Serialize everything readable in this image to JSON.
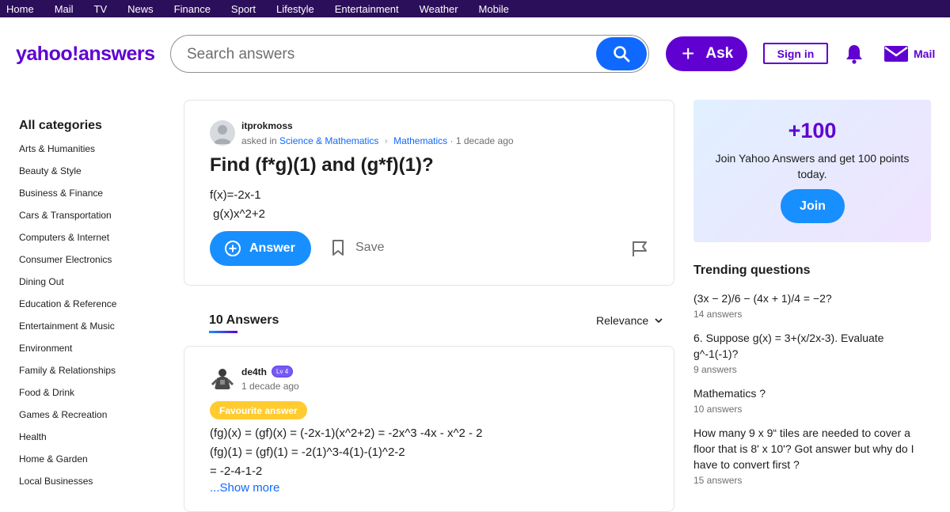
{
  "topnav": [
    "Home",
    "Mail",
    "TV",
    "News",
    "Finance",
    "Sport",
    "Lifestyle",
    "Entertainment",
    "Weather",
    "Mobile"
  ],
  "header": {
    "logo": "yahoo!answers",
    "search_placeholder": "Search answers",
    "ask_label": "Ask",
    "signin_label": "Sign in",
    "mail_label": "Mail"
  },
  "sidebar": {
    "title": "All categories",
    "categories": [
      "Arts & Humanities",
      "Beauty & Style",
      "Business & Finance",
      "Cars & Transportation",
      "Computers & Internet",
      "Consumer Electronics",
      "Dining Out",
      "Education & Reference",
      "Entertainment & Music",
      "Environment",
      "Family & Relationships",
      "Food & Drink",
      "Games & Recreation",
      "Health",
      "Home & Garden",
      "Local Businesses"
    ]
  },
  "question": {
    "user": "itprokmoss",
    "asked_in": "asked in",
    "category": "Science & Mathematics",
    "subcategory": "Mathematics",
    "time": "· 1 decade ago",
    "title": "Find (f*g)(1) and (g*f)(1)?",
    "body": "f(x)=-2x-1\n g(x)x^2+2",
    "answer_label": "Answer",
    "save_label": "Save"
  },
  "answers": {
    "count_label": "10 Answers",
    "sort_label": "Relevance",
    "items": [
      {
        "user": "de4th",
        "level": "Lv 4",
        "time": "1 decade ago",
        "badge": "Favourite answer",
        "body": "(fg)(x) = (gf)(x) = (-2x-1)(x^2+2) = -2x^3 -4x - x^2 - 2\n(fg)(1) = (gf)(1) = -2(1)^3-4(1)-(1)^2-2\n= -2-4-1-2",
        "show_more": "...Show more"
      }
    ]
  },
  "promo": {
    "points": "+100",
    "description": "Join Yahoo Answers and get 100 points today.",
    "join_label": "Join"
  },
  "trending": {
    "title": "Trending questions",
    "items": [
      {
        "question": "(3x − 2)/6 − (4x + 1)/4 = −2?",
        "count": "14 answers"
      },
      {
        "question": "6. Suppose g(x) = 3+(x/2x-3).  Evaluate g^-1(-1)?",
        "count": "9 answers"
      },
      {
        "question": "Mathematics ?",
        "count": "10 answers"
      },
      {
        "question": "How many 9 x 9“ tiles are needed to cover a floor that is 8' x 10'? Got answer but why do I have to convert first ?",
        "count": "15 answers"
      }
    ]
  },
  "colors": {
    "topbar": "#2c0f5a",
    "brand": "#6001d2",
    "blue": "#188fff",
    "link": "#0f69ff",
    "favourite": "#ffcb2f"
  }
}
